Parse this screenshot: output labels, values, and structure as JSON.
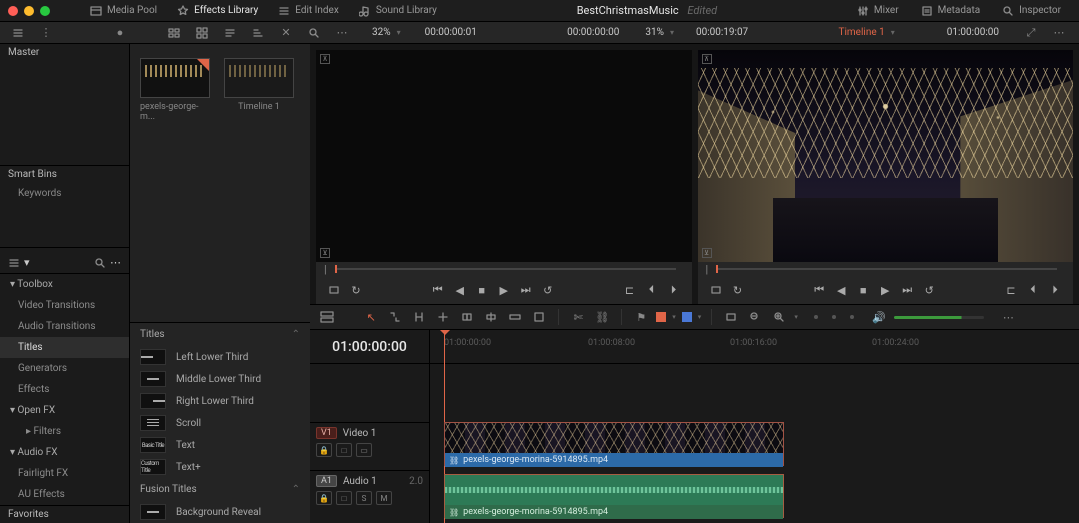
{
  "app": {
    "title": "BestChristmasMusic",
    "status": "Edited"
  },
  "workspace_tabs": [
    {
      "id": "media-pool",
      "label": "Media Pool",
      "icon": "media-pool-icon",
      "active": false
    },
    {
      "id": "effects",
      "label": "Effects Library",
      "icon": "effects-icon",
      "active": true
    },
    {
      "id": "edit-index",
      "label": "Edit Index",
      "icon": "edit-index-icon",
      "active": false
    },
    {
      "id": "sound",
      "label": "Sound Library",
      "icon": "sound-icon",
      "active": false
    }
  ],
  "top_right_tabs": [
    {
      "id": "mixer",
      "label": "Mixer",
      "icon": "mixer-icon"
    },
    {
      "id": "metadata",
      "label": "Metadata",
      "icon": "metadata-icon"
    },
    {
      "id": "inspector",
      "label": "Inspector",
      "icon": "inspector-icon"
    }
  ],
  "subbar": {
    "left_icons": [
      "list-icon",
      "filter-icon"
    ],
    "view_icons": [
      "thumb-icon",
      "list-view-icon",
      "grid-icon",
      "sort-icon",
      "crop-icon",
      "search-icon",
      "more-icon"
    ],
    "src_zoom": "32%",
    "src_tc": "00:00:00:01",
    "prog_tc": "00:00:00:00",
    "prog_zoom": "31%",
    "prog_dur": "00:00:19:07",
    "timeline_menu": "Timeline 1",
    "record_tc": "01:00:00:00"
  },
  "media_panel": {
    "master": "Master",
    "smartbins_header": "Smart Bins",
    "smartbins": [
      "Keywords"
    ],
    "favorites": "Favorites"
  },
  "clips": [
    {
      "name": "pexels-george-m...",
      "thumb": "video"
    },
    {
      "name": "Timeline 1",
      "thumb": "timeline"
    }
  ],
  "fx_nav": {
    "groups": [
      {
        "label": "Toolbox",
        "open": true,
        "items": [
          {
            "label": "Video Transitions"
          },
          {
            "label": "Audio Transitions"
          },
          {
            "label": "Titles",
            "selected": true
          },
          {
            "label": "Generators"
          },
          {
            "label": "Effects"
          }
        ]
      },
      {
        "label": "Open FX",
        "open": true,
        "items": [
          {
            "label": "Filters",
            "indent": true
          }
        ]
      },
      {
        "label": "Audio FX",
        "open": true,
        "items": [
          {
            "label": "Fairlight FX"
          },
          {
            "label": "AU Effects"
          }
        ]
      }
    ]
  },
  "fx_list": {
    "header_titles": "Titles",
    "items_titles": [
      {
        "label": "Left Lower Third",
        "preview": "bar-left"
      },
      {
        "label": "Middle Lower Third",
        "preview": "bar-mid"
      },
      {
        "label": "Right Lower Third",
        "preview": "bar-right"
      },
      {
        "label": "Scroll",
        "preview": "lines"
      },
      {
        "label": "Text",
        "preview": "text-basic",
        "tag": "Basic Title"
      },
      {
        "label": "Text+",
        "preview": "text-custom",
        "tag": "Custom Title"
      }
    ],
    "header_fusion": "Fusion Titles",
    "items_fusion": [
      {
        "label": "Background Reveal",
        "preview": "reveal"
      }
    ]
  },
  "transport_icons": {
    "left": [
      "match-frame-icon",
      "loop-playback-icon"
    ],
    "center": [
      "first-frame-icon",
      "step-back-icon",
      "stop-icon",
      "play-icon",
      "step-fwd-icon",
      "last-frame-icon"
    ],
    "right": [
      "loop-icon",
      "prev-edit-icon",
      "next-edit-icon"
    ]
  },
  "tl_toolbar": {
    "left": [
      "timeline-view-options-icon"
    ],
    "tools": [
      "selection-icon",
      "blade-icon",
      "trim-icon",
      "position-icon",
      "dyn-trim-icon",
      "insert-icon",
      "overwrite-icon",
      "replace-icon"
    ],
    "link": [
      "blade-tool-icon",
      "link-icon"
    ],
    "flags": [
      {
        "color": "red"
      },
      {
        "color": "blue"
      }
    ],
    "zoom": [
      "marker-icon",
      "zoom-out-icon",
      "zoom-in-icon",
      "zoom-fit-icon"
    ],
    "audio": [
      "mute-icon"
    ]
  },
  "timeline": {
    "tc": "01:00:00:00",
    "ruler": [
      "01:00:00:00",
      "01:00:08:00",
      "01:00:16:00",
      "01:00:24:00"
    ],
    "video_track": {
      "badge": "V1",
      "name": "Video 1",
      "buttons": [
        "lock-icon",
        "auto-select-icon",
        "toggle-icon"
      ]
    },
    "audio_track": {
      "badge": "A1",
      "name": "Audio 1",
      "ch": "2.0",
      "buttons": [
        "lock-icon",
        "auto-select-icon",
        "S",
        "M"
      ]
    },
    "clip_label": "pexels-george-morina-5914895.mp4"
  }
}
